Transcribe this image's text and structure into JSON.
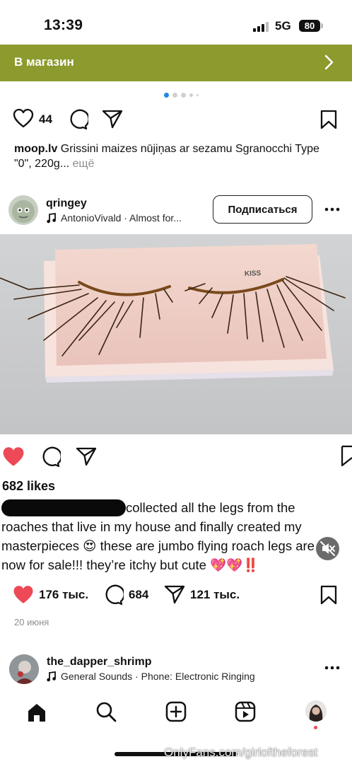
{
  "status_bar": {
    "time": "13:39",
    "network": "5G",
    "battery": "80"
  },
  "shop_bar": {
    "label": "В магазин"
  },
  "carousel": {
    "dots": 5,
    "active": 0
  },
  "post1": {
    "likes": "44",
    "caption_user": "moop.lv",
    "caption_text": "Grissini maizes nūjiņas ar sezamu Sgranocchi Type \"0\", 220g...",
    "more": "ещё"
  },
  "post2": {
    "username": "qringey",
    "audio": "AntonioVivald · Almost for...",
    "follow_label": "Подписаться",
    "image_brand": "KISS",
    "meme": {
      "likes": "682 likes",
      "text_part1": "collected all the legs from the",
      "text_part2": "roaches that live in my house and finally created my",
      "text_part3": "masterpieces 😍 these are jumbo flying roach legs are",
      "text_part4": "now for sale!!! they’re itchy but cute 💖💖‼️"
    },
    "likes": "176 тыс.",
    "comments": "684",
    "shares": "121 тыс.",
    "date": "20 июня"
  },
  "post3": {
    "username": "the_dapper_shrimp",
    "audio": "General Sounds · Phone: Electronic Ringing"
  },
  "watermark": "OnlyFans.com/girloftheforest",
  "colors": {
    "like_red": "#ed4956",
    "shop_green": "#8c9a2e",
    "dot_blue": "#1e88e5"
  }
}
